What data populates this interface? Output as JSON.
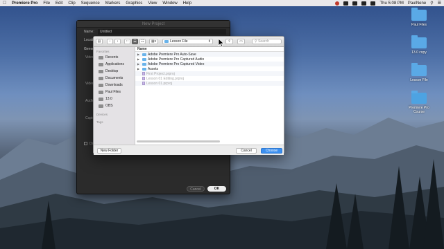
{
  "menubar": {
    "app": "Premiere Pro",
    "items": [
      "File",
      "Edit",
      "Clip",
      "Sequence",
      "Markers",
      "Graphics",
      "View",
      "Window",
      "Help"
    ],
    "clock": "Thu 5:08 PM",
    "user": "PaulNene"
  },
  "desktop": {
    "icons": [
      {
        "label": "Paul Files"
      },
      {
        "label": "13.0 copy"
      },
      {
        "label": "Lesson File"
      },
      {
        "label": "Premiere Pro Course"
      }
    ]
  },
  "new_project": {
    "title": "New Project",
    "name_label": "Name:",
    "name_value": "Untitled",
    "location_label": "Locati",
    "general_tab": "Genera",
    "video_label": "Video",
    "video_label2": "Video",
    "audio_label": "Audio",
    "capture_label": "Captu",
    "disp_label": "Dis",
    "cancel": "Cancel",
    "ok": "OK"
  },
  "picker": {
    "path": "Lesson File",
    "search_placeholder": "Search",
    "sidebar_headers": {
      "favorites": "Favorites",
      "devices": "Devices",
      "tags": "Tags"
    },
    "favorites": [
      "Recents",
      "Applications",
      "Desktop",
      "Documents",
      "Downloads",
      "Paul Files",
      "13.0",
      "OBS"
    ],
    "column_name": "Name",
    "files": [
      {
        "name": "Adobe Premiere Pro Auto-Save",
        "type": "folder"
      },
      {
        "name": "Adobe Premiere Pro Captured Audio",
        "type": "folder"
      },
      {
        "name": "Adobe Premiere Pro Captured Video",
        "type": "folder"
      },
      {
        "name": "Assets",
        "type": "folder"
      },
      {
        "name": "First Project.prproj",
        "type": "file"
      },
      {
        "name": "Lesson 01 Editing.prproj",
        "type": "file"
      },
      {
        "name": "Lesson 01.prproj",
        "type": "file"
      }
    ],
    "new_folder": "New Folder",
    "cancel": "Cancel",
    "choose": "Choose"
  }
}
